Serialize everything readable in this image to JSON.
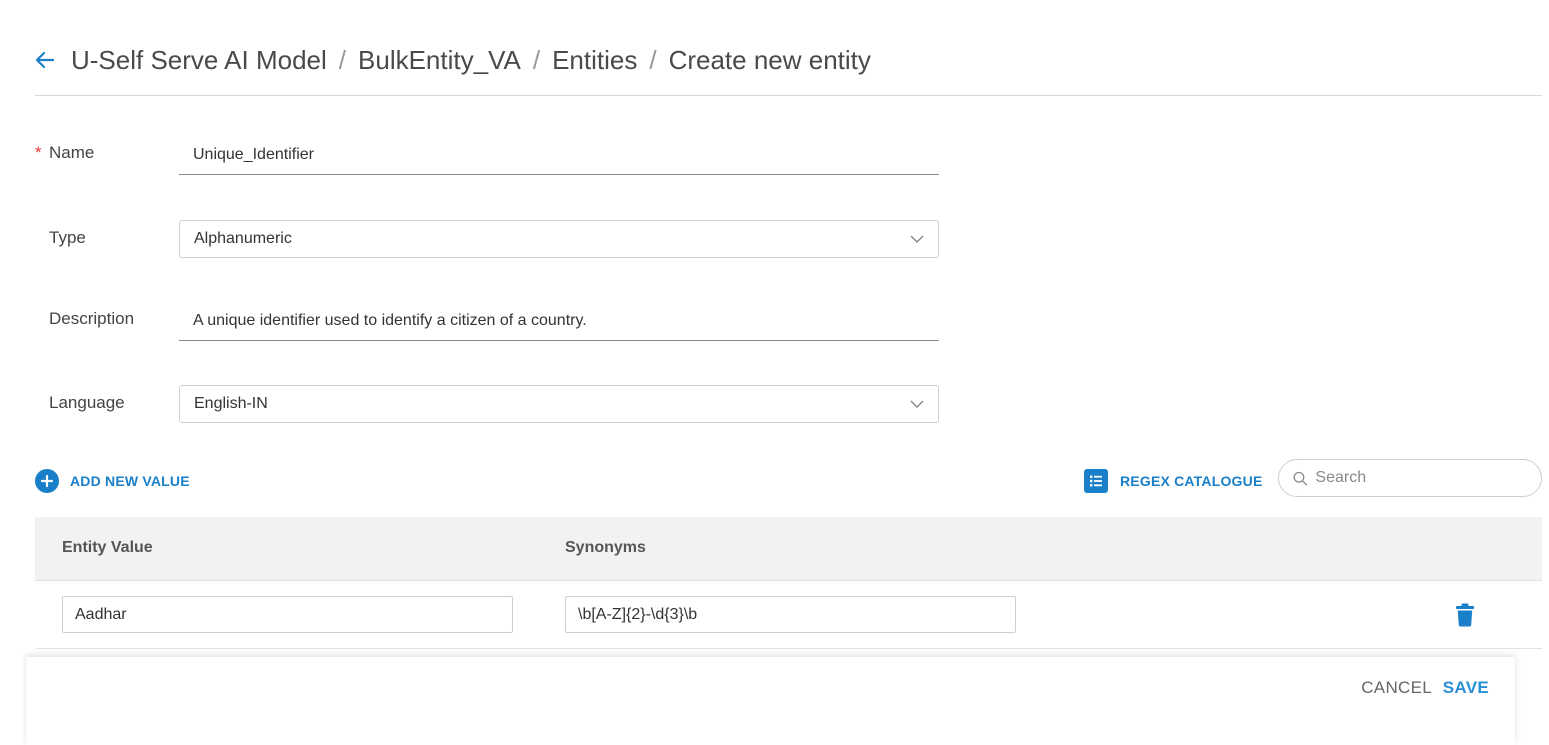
{
  "breadcrumb": {
    "items": [
      "U-Self Serve AI Model",
      "BulkEntity_VA",
      "Entities",
      "Create new entity"
    ],
    "separator": "/"
  },
  "form": {
    "name": {
      "label": "Name",
      "required_marker": "*",
      "value": "Unique_Identifier"
    },
    "type": {
      "label": "Type",
      "value": "Alphanumeric"
    },
    "description": {
      "label": "Description",
      "value": "A unique identifier used to identify a citizen of a country."
    },
    "language": {
      "label": "Language",
      "value": "English-IN"
    }
  },
  "toolbar": {
    "add_new_label": "ADD NEW VALUE",
    "regex_label": "REGEX CATALOGUE",
    "search_placeholder": "Search"
  },
  "table": {
    "headers": [
      "Entity Value",
      "Synonyms"
    ],
    "rows": [
      {
        "entity_value": "Aadhar",
        "synonyms": "\\b[A-Z]{2}-\\d{3}\\b"
      }
    ]
  },
  "footer": {
    "cancel_label": "CANCEL",
    "save_label": "SAVE"
  },
  "colors": {
    "accent": "#1a7fc9",
    "save": "#2a90d8",
    "required": "#e53935"
  },
  "icons": {
    "back": "arrow-left-icon",
    "chevron": "chevron-down-icon",
    "add": "plus-circle-icon",
    "regex": "list-icon",
    "search": "search-icon",
    "delete": "trash-icon"
  }
}
